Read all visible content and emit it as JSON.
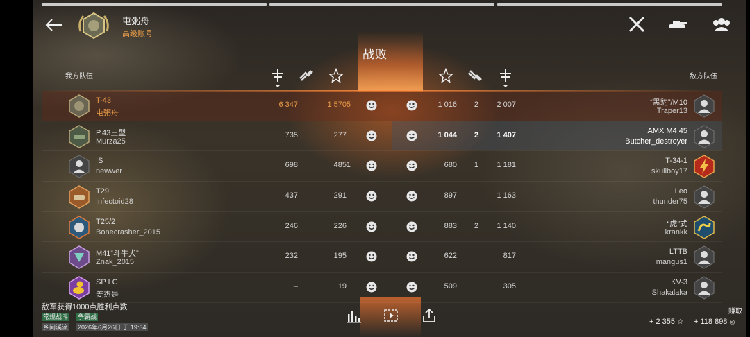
{
  "header": {
    "player_name": "屯粥舟",
    "account_type": "高级账号",
    "result": "战败"
  },
  "teams": {
    "ally_label": "我方队伍",
    "enemy_label": "敌方队伍"
  },
  "rows": [
    {
      "ally_tank": "T-43",
      "ally_player": "屯粥舟",
      "ally_dmg": "6 347",
      "ally_kills": "5",
      "ally_xp": "1 570",
      "enemy_tank": "“黑豹”/M10",
      "enemy_player": "Traper13",
      "enemy_xp": "1 016",
      "enemy_kills": "2",
      "enemy_dmg": "2 007"
    },
    {
      "ally_tank": "P.43三型",
      "ally_player": "Murza25",
      "ally_dmg": "735",
      "ally_kills": "",
      "ally_xp": "277",
      "enemy_tank": "AMX M4 45",
      "enemy_player": "Butcher_destroyer",
      "enemy_xp": "1 044",
      "enemy_kills": "2",
      "enemy_dmg": "1 407"
    },
    {
      "ally_tank": "IS",
      "ally_player": "newwer",
      "ally_dmg": "698",
      "ally_kills": "1",
      "ally_xp": "485",
      "enemy_tank": "T-34-1",
      "enemy_player": "skullboy17",
      "enemy_xp": "680",
      "enemy_kills": "1",
      "enemy_dmg": "1 181"
    },
    {
      "ally_tank": "T29",
      "ally_player": "Infectoid28",
      "ally_dmg": "437",
      "ally_kills": "",
      "ally_xp": "291",
      "enemy_tank": "Leo",
      "enemy_player": "thunder75",
      "enemy_xp": "897",
      "enemy_kills": "",
      "enemy_dmg": "1 163"
    },
    {
      "ally_tank": "T25/2",
      "ally_player": "Bonecrasher_2015",
      "ally_dmg": "246",
      "ally_kills": "",
      "ally_xp": "226",
      "enemy_tank": "“虎”式",
      "enemy_player": "krankk",
      "enemy_xp": "883",
      "enemy_kills": "2",
      "enemy_dmg": "1 140"
    },
    {
      "ally_tank": "M41“斗牛犬”",
      "ally_player": "Znak_2015",
      "ally_dmg": "232",
      "ally_kills": "",
      "ally_xp": "195",
      "enemy_tank": "LTTB",
      "enemy_player": "mangus1",
      "enemy_xp": "622",
      "enemy_kills": "",
      "enemy_dmg": "817"
    },
    {
      "ally_tank": "SP I C",
      "ally_player": "姜杰是",
      "ally_dmg": "–",
      "ally_kills": "",
      "ally_xp": "19",
      "enemy_tank": "KV-3",
      "enemy_player": "Shakalaka",
      "enemy_xp": "509",
      "enemy_kills": "",
      "enemy_dmg": "305"
    }
  ],
  "footer": {
    "message": "敌军获得1000点胜利点数",
    "tags": [
      "常规战斗",
      "争霸战",
      "乡间溪流",
      "2026年6月26日 于 19:34"
    ],
    "earn_label": "赚取",
    "xp": "+ 2 355",
    "credits": "+ 118 898"
  },
  "colors": {
    "accent_orange": "#e89a48",
    "premium": "#f2a14a",
    "tag_green": "#2f6d45"
  }
}
